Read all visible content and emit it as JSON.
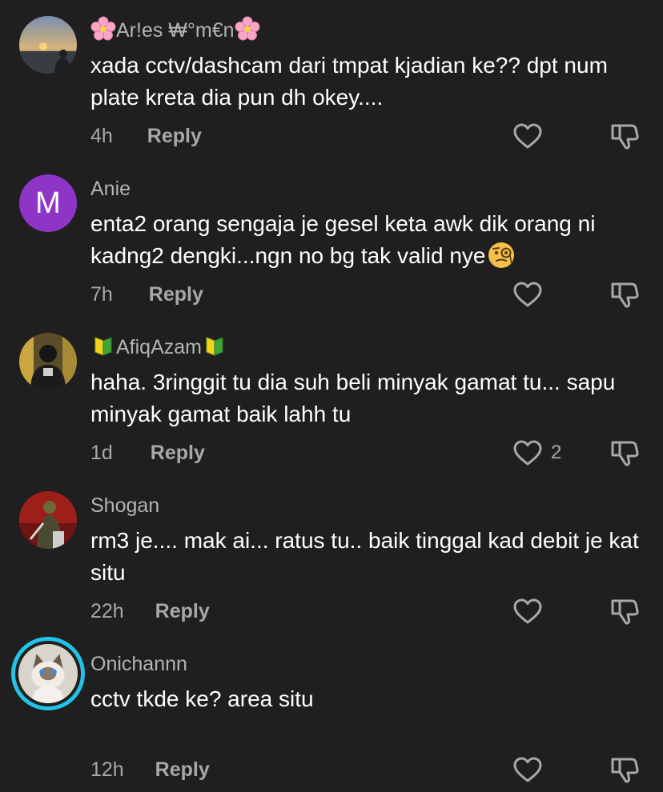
{
  "comments": [
    {
      "username": "Ar!es ₩°m€n",
      "username_prefix_icon": "cherry-blossom-emoji",
      "username_suffix_icon": "cherry-blossom-emoji",
      "avatar_icon": "sunset-photo-avatar",
      "text": "xada cctv/dashcam dari tmpat kjadian ke?? dpt num plate kreta dia pun dh okey....",
      "time": "4h",
      "reply_label": "Reply",
      "like_icon": "heart-outline-icon",
      "like_count": "",
      "dislike_icon": "thumbs-down-icon"
    },
    {
      "username": "Anie",
      "avatar_letter": "M",
      "avatar_color": "#8e35c7",
      "text": "enta2 orang sengaja je gesel keta awk dik orang ni kadng2 dengki...ngn no bg tak valid nye",
      "text_suffix_icon": "face-with-monocle-emoji",
      "time": "7h",
      "reply_label": "Reply",
      "like_icon": "heart-outline-icon",
      "like_count": "",
      "dislike_icon": "thumbs-down-icon"
    },
    {
      "username": "AfiqAzam",
      "username_prefix_icon": "japanese-beginner-symbol-emoji",
      "username_suffix_icon": "japanese-beginner-symbol-emoji",
      "avatar_icon": "person-photo-avatar",
      "text": "haha. 3ringgit tu dia suh beli minyak gamat tu... sapu minyak gamat baik lahh tu",
      "time": "1d",
      "reply_label": "Reply",
      "like_icon": "heart-outline-icon",
      "like_count": "2",
      "dislike_icon": "thumbs-down-icon"
    },
    {
      "username": "Shogan",
      "avatar_icon": "warrior-photo-avatar",
      "text": "rm3 je.... mak ai... ratus tu.. baik tinggal kad debit je kat situ",
      "time": "22h",
      "reply_label": "Reply",
      "like_icon": "heart-outline-icon",
      "like_count": "",
      "dislike_icon": "thumbs-down-icon"
    },
    {
      "username": "Onichannn",
      "avatar_icon": "cat-photo-avatar",
      "avatar_ring_color": "#22c3e6",
      "text": "cctv tkde ke? area situ",
      "time": "12h",
      "reply_label": "Reply",
      "like_icon": "heart-outline-icon",
      "like_count": "",
      "dislike_icon": "thumbs-down-icon"
    }
  ]
}
